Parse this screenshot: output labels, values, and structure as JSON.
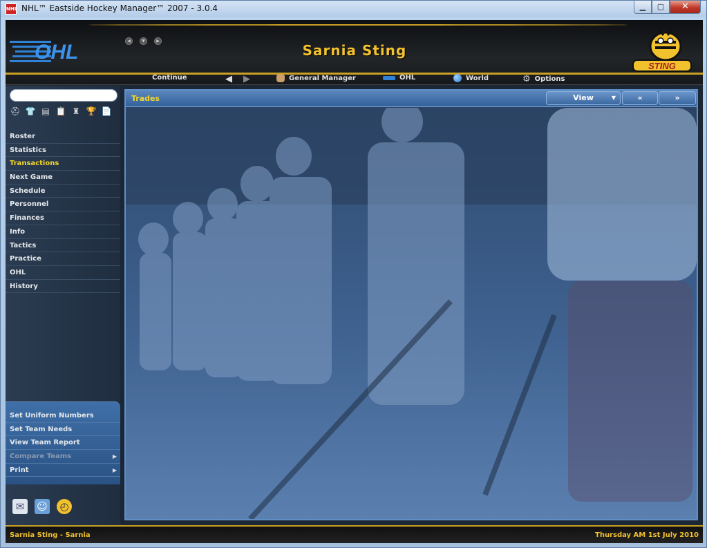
{
  "window": {
    "title": "NHL™ Eastside Hockey Manager™ 2007 - 3.0.4",
    "app_icon_text": "NHL"
  },
  "header": {
    "team_title": "Sarnia Sting",
    "logo_text": "OHL",
    "team_logo_text": "STING"
  },
  "nav": {
    "continue": "Continue",
    "general_manager": "General Manager",
    "ohl": "OHL",
    "world": "World",
    "options": "Options"
  },
  "sidebar": {
    "icons": [
      "helmet-icon",
      "jersey-icon",
      "board-icon",
      "clipboard-icon",
      "player-icon",
      "trophy-icon",
      "document-icon"
    ],
    "menu": [
      {
        "label": "Roster"
      },
      {
        "label": "Statistics"
      },
      {
        "label": "Transactions",
        "active": true
      },
      {
        "label": "Next Game"
      },
      {
        "label": "Schedule"
      },
      {
        "label": "Personnel"
      },
      {
        "label": "Finances"
      },
      {
        "label": "Info"
      },
      {
        "label": "Tactics"
      },
      {
        "label": "Practice"
      },
      {
        "label": "OHL"
      },
      {
        "label": "History"
      }
    ],
    "actions": [
      {
        "label": "Set Uniform Numbers"
      },
      {
        "label": "Set Team Needs"
      },
      {
        "label": "View Team Report"
      },
      {
        "label": "Compare Teams",
        "disabled": true
      },
      {
        "label": "Print"
      }
    ]
  },
  "content": {
    "title": "Trades",
    "view_button": "View",
    "prev_button": "«",
    "next_button": "»"
  },
  "status": {
    "left": "Sarnia Sting - Sarnia",
    "right": "Thursday AM 1st July 2010"
  },
  "colors": {
    "accent_gold": "#f2c12e",
    "active_menu": "#f3d72a",
    "panel_blue": "#3c68a1"
  }
}
